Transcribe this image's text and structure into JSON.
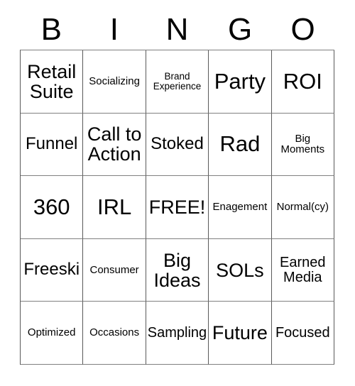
{
  "card": {
    "title": "BINGO",
    "free_space_label": "FREE!",
    "columns": [
      "B",
      "I",
      "N",
      "G",
      "O"
    ],
    "rows": [
      [
        {
          "text": "Retail\nSuite",
          "size": "xl"
        },
        {
          "text": "Socializing",
          "size": "sm"
        },
        {
          "text": "Brand\nExperience",
          "size": "xs"
        },
        {
          "text": "Party",
          "size": "xxl"
        },
        {
          "text": "ROI",
          "size": "xxl"
        }
      ],
      [
        {
          "text": "Funnel",
          "size": "lg"
        },
        {
          "text": "Call to\nAction",
          "size": "xl"
        },
        {
          "text": "Stoked",
          "size": "lg"
        },
        {
          "text": "Rad",
          "size": "xxl"
        },
        {
          "text": "Big\nMoments",
          "size": "sm"
        }
      ],
      [
        {
          "text": "360",
          "size": "xxl"
        },
        {
          "text": "IRL",
          "size": "xxl"
        },
        {
          "text": "FREE!",
          "size": "xl"
        },
        {
          "text": "Enagement",
          "size": "sm"
        },
        {
          "text": "Normal(cy)",
          "size": "sm"
        }
      ],
      [
        {
          "text": "Freeski",
          "size": "lg"
        },
        {
          "text": "Consumer",
          "size": "sm"
        },
        {
          "text": "Big\nIdeas",
          "size": "xl"
        },
        {
          "text": "SOLs",
          "size": "xl"
        },
        {
          "text": "Earned\nMedia",
          "size": "md"
        }
      ],
      [
        {
          "text": "Optimized",
          "size": "sm"
        },
        {
          "text": "Occasions",
          "size": "sm"
        },
        {
          "text": "Sampling",
          "size": "md"
        },
        {
          "text": "Future",
          "size": "xl"
        },
        {
          "text": "Focused",
          "size": "md"
        }
      ]
    ]
  },
  "colors": {
    "background": "#ffffff",
    "text": "#000000",
    "border_vertical": "#5a5a5a",
    "border_horizontal": "#808080"
  }
}
